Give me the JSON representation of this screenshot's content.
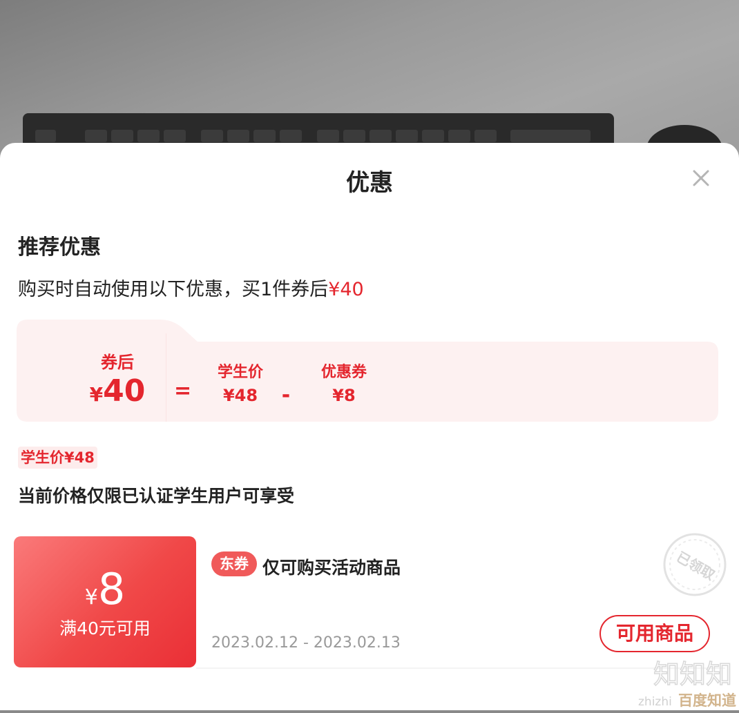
{
  "sheet": {
    "title": "优惠",
    "close_icon": "close-icon"
  },
  "recommend": {
    "title": "推荐优惠",
    "desc_prefix": "购买时自动使用以下优惠，买1件券后",
    "desc_price": "¥40"
  },
  "breakdown": {
    "after_label": "券后",
    "after_currency": "¥",
    "after_value": "40",
    "equals": "=",
    "student_label": "学生价",
    "student_value": "¥48",
    "minus": "-",
    "coupon_label": "优惠券",
    "coupon_value": "¥8"
  },
  "student": {
    "tag": "学生价¥48",
    "note": "当前价格仅限已认证学生用户可享受"
  },
  "coupon": {
    "currency": "¥",
    "amount": "8",
    "condition": "满40元可用",
    "badge": "东券",
    "desc": "仅可购买活动商品",
    "date_range": "2023.02.12 - 2023.02.13",
    "button": "可用商品",
    "stamp_text": "已领取"
  },
  "watermark": {
    "top": "知知知",
    "brand_prefix": "zhizhi",
    "brand": "百度知道"
  },
  "colors": {
    "accent": "#e4262e",
    "coupon_gradient_start": "#fa7a7a",
    "coupon_gradient_end": "#ea2f36",
    "breakdown_bg": "#fdf1f1"
  }
}
